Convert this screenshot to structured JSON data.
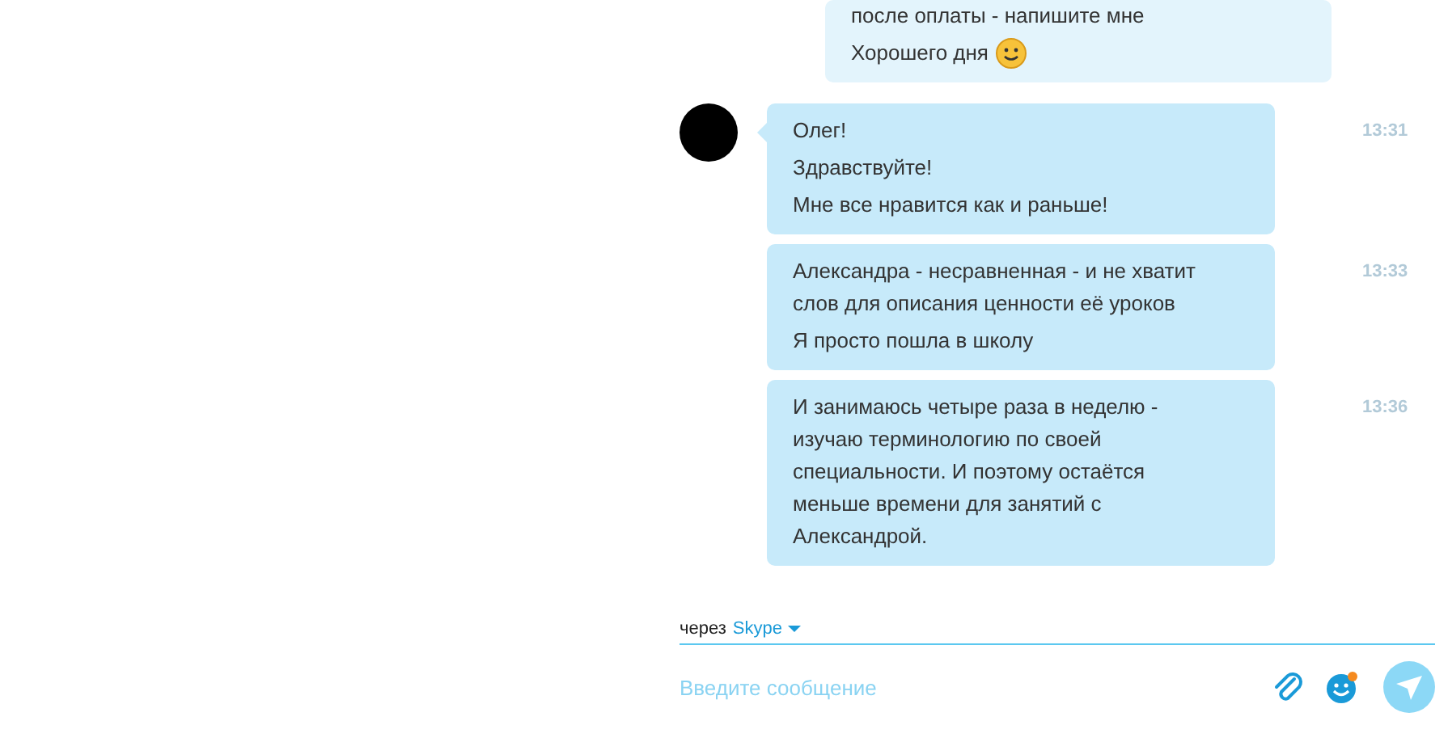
{
  "messages": [
    {
      "kind": "outgoing",
      "paragraphs": [
        {
          "lines": [
            "после оплаты - напишите мне"
          ]
        },
        {
          "lines": [
            "Хорошего дня"
          ],
          "emoticon": true
        }
      ]
    },
    {
      "kind": "incoming",
      "avatar": true,
      "time": "13:31",
      "paragraphs": [
        {
          "lines": [
            "Олег!"
          ]
        },
        {
          "lines": [
            "Здравствуйте!"
          ]
        },
        {
          "lines": [
            "Мне все нравится как и раньше!"
          ]
        }
      ]
    },
    {
      "kind": "incoming",
      "time": "13:33",
      "paragraphs": [
        {
          "lines": [
            "Александра - несравненная - и не хватит",
            "слов для описания ценности её уроков"
          ]
        },
        {
          "lines": [
            "Я просто пошла в школу"
          ]
        }
      ]
    },
    {
      "kind": "incoming",
      "time": "13:36",
      "paragraphs": [
        {
          "lines": [
            "И занимаюсь четыре раза в неделю -",
            "изучаю терминологию по своей",
            "специальности. И поэтому остаётся",
            "меньше времени для занятий с",
            "Александрой."
          ]
        }
      ]
    }
  ],
  "composer": {
    "via_label": "через",
    "via_service": "Skype",
    "placeholder": "Введите сообщение",
    "emoji_notification": true
  }
}
